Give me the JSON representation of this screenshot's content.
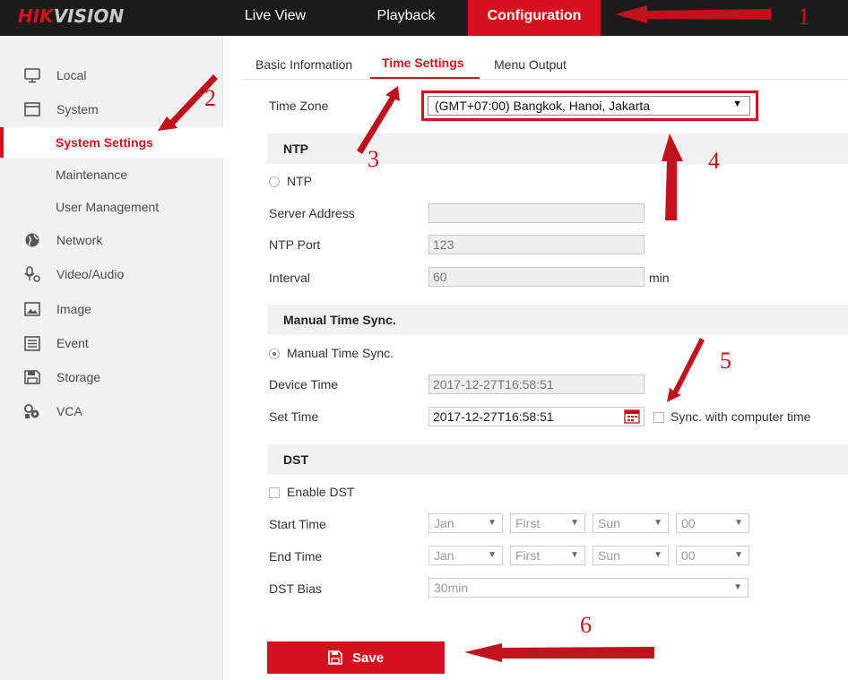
{
  "topbar": {
    "logo_hik": "HIK",
    "logo_vision": "VISION",
    "nav": [
      {
        "label": "Live View"
      },
      {
        "label": "Playback"
      },
      {
        "label": "Configuration",
        "active": true
      }
    ]
  },
  "sidebar": {
    "items": [
      {
        "label": "Local",
        "icon": "monitor-icon"
      },
      {
        "label": "System",
        "icon": "system-icon"
      },
      {
        "label": "System Settings",
        "active": true
      },
      {
        "label": "Maintenance"
      },
      {
        "label": "User Management"
      },
      {
        "label": "Network",
        "icon": "globe-icon"
      },
      {
        "label": "Video/Audio",
        "icon": "microphone-camera-icon"
      },
      {
        "label": "Image",
        "icon": "image-icon"
      },
      {
        "label": "Event",
        "icon": "calendar-event-icon"
      },
      {
        "label": "Storage",
        "icon": "floppy-disk-icon"
      },
      {
        "label": "VCA",
        "icon": "vca-icon"
      }
    ]
  },
  "tabs": [
    {
      "label": "Basic Information"
    },
    {
      "label": "Time Settings",
      "active": true
    },
    {
      "label": "Menu Output"
    }
  ],
  "time_zone": {
    "label": "Time Zone",
    "value": "(GMT+07:00) Bangkok, Hanoi, Jakarta"
  },
  "ntp": {
    "section_title": "NTP",
    "option_label": "NTP",
    "selected": false,
    "server_address_label": "Server Address",
    "server_address_value": "",
    "port_label": "NTP Port",
    "port_value": "123",
    "interval_label": "Interval",
    "interval_value": "60",
    "interval_unit": "min"
  },
  "manual_sync": {
    "section_title": "Manual Time Sync.",
    "option_label": "Manual Time Sync.",
    "selected": true,
    "device_time_label": "Device Time",
    "device_time_value": "2017-12-27T16:58:51",
    "set_time_label": "Set Time",
    "set_time_value": "2017-12-27T16:58:51",
    "sync_label": "Sync. with computer time",
    "sync_checked": false
  },
  "dst": {
    "section_title": "DST",
    "enable_label": "Enable DST",
    "enabled": false,
    "start_label": "Start Time",
    "end_label": "End Time",
    "bias_label": "DST Bias",
    "start": {
      "month": "Jan",
      "week": "First",
      "day": "Sun",
      "hour": "00"
    },
    "end": {
      "month": "Jan",
      "week": "First",
      "day": "Sun",
      "hour": "00"
    },
    "bias_value": "30min"
  },
  "save_button": {
    "label": "Save",
    "icon": "save-icon"
  },
  "annotations": {
    "color": "#c0121c",
    "numbers": [
      "1",
      "2",
      "3",
      "4",
      "5",
      "6"
    ]
  },
  "colors": {
    "accent": "#d5111f",
    "topbar_bg": "#1b1b1b",
    "sidebar_bg": "#f1f1f1"
  }
}
